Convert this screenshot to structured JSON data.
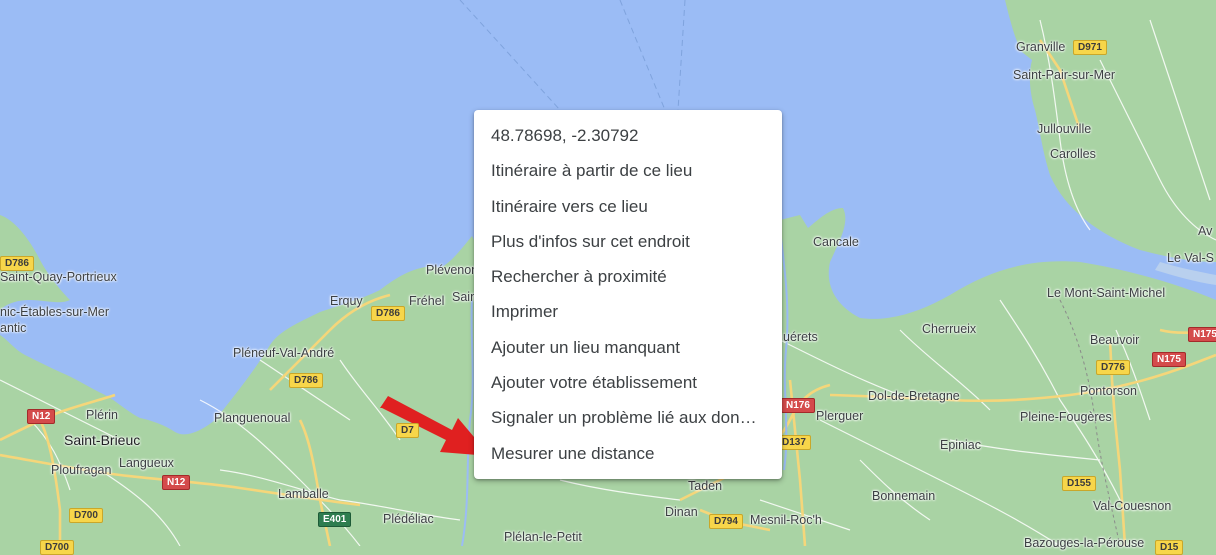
{
  "map": {
    "colors": {
      "water": "#9bbcf5",
      "land": "#a9d3a4",
      "road_major": "#f5d67a",
      "road_minor": "#ffffff",
      "arrow": "#e02020"
    },
    "places": [
      {
        "name": "Granville",
        "kind": "town"
      },
      {
        "name": "Saint-Pair-sur-Mer",
        "kind": "town"
      },
      {
        "name": "Jullouville",
        "kind": "town"
      },
      {
        "name": "Carolles",
        "kind": "town"
      },
      {
        "name": "Cancale",
        "kind": "town"
      },
      {
        "name": "Le Mont-Saint-Michel",
        "kind": "town"
      },
      {
        "name": "Le Val-S",
        "kind": "town"
      },
      {
        "name": "Av",
        "kind": "town"
      },
      {
        "name": "Cherrueix",
        "kind": "town"
      },
      {
        "name": "Beauvoir",
        "kind": "town"
      },
      {
        "name": "Pontorson",
        "kind": "town"
      },
      {
        "name": "Dol-de-Bretagne",
        "kind": "town"
      },
      {
        "name": "Pleine-Fougères",
        "kind": "town"
      },
      {
        "name": "Plerguer",
        "kind": "town"
      },
      {
        "name": "Epiniac",
        "kind": "town"
      },
      {
        "name": "Bonnemain",
        "kind": "town"
      },
      {
        "name": "Val-Couesnon",
        "kind": "town"
      },
      {
        "name": "Bazouges-la-Pérouse",
        "kind": "town"
      },
      {
        "name": "uérets",
        "kind": "town"
      },
      {
        "name": "Taden",
        "kind": "town"
      },
      {
        "name": "Dinan",
        "kind": "town"
      },
      {
        "name": "Mesnil-Roc'h",
        "kind": "town"
      },
      {
        "name": "Plélan-le-Petit",
        "kind": "town"
      },
      {
        "name": "Plédéliac",
        "kind": "town"
      },
      {
        "name": "Lamballe",
        "kind": "town"
      },
      {
        "name": "Planguenoual",
        "kind": "town"
      },
      {
        "name": "Pléneuf-Val-André",
        "kind": "town"
      },
      {
        "name": "Erquy",
        "kind": "town"
      },
      {
        "name": "Fréhel",
        "kind": "town"
      },
      {
        "name": "Plévenon",
        "kind": "town"
      },
      {
        "name": "Sain",
        "kind": "town"
      },
      {
        "name": "Saint-Quay-Portrieux",
        "kind": "town"
      },
      {
        "name": "nic-Étables-sur-Mer",
        "kind": "town"
      },
      {
        "name": "antic",
        "kind": "town"
      },
      {
        "name": "Plérin",
        "kind": "town"
      },
      {
        "name": "Saint-Brieuc",
        "kind": "city"
      },
      {
        "name": "Ploufragan",
        "kind": "town"
      },
      {
        "name": "Langueux",
        "kind": "town"
      }
    ],
    "road_shields": [
      {
        "label": "D971",
        "style": "yellow"
      },
      {
        "label": "D786",
        "style": "yellow"
      },
      {
        "label": "D786",
        "style": "yellow"
      },
      {
        "label": "D786",
        "style": "yellow"
      },
      {
        "label": "N12",
        "style": "red"
      },
      {
        "label": "N12",
        "style": "red"
      },
      {
        "label": "D700",
        "style": "yellow"
      },
      {
        "label": "D700",
        "style": "yellow"
      },
      {
        "label": "E401",
        "style": "green"
      },
      {
        "label": "D794",
        "style": "yellow"
      },
      {
        "label": "N176",
        "style": "red"
      },
      {
        "label": "D137",
        "style": "yellow"
      },
      {
        "label": "D776",
        "style": "yellow"
      },
      {
        "label": "N175",
        "style": "red"
      },
      {
        "label": "N175",
        "style": "red"
      },
      {
        "label": "D155",
        "style": "yellow"
      },
      {
        "label": "D7",
        "style": "yellow"
      },
      {
        "label": "D15",
        "style": "yellow"
      }
    ]
  },
  "context_menu": {
    "items": [
      {
        "label": "48.78698, -2.30792"
      },
      {
        "label": "Itinéraire à partir de ce lieu"
      },
      {
        "label": "Itinéraire vers ce lieu"
      },
      {
        "label": "Plus d'infos sur cet endroit"
      },
      {
        "label": "Rechercher à proximité"
      },
      {
        "label": "Imprimer"
      },
      {
        "label": "Ajouter un lieu manquant"
      },
      {
        "label": "Ajouter votre établissement"
      },
      {
        "label": "Signaler un problème lié aux données cartographiques"
      },
      {
        "label": "Mesurer une distance"
      }
    ]
  },
  "annotation": {
    "arrow_icon": "red-arrow-icon"
  }
}
